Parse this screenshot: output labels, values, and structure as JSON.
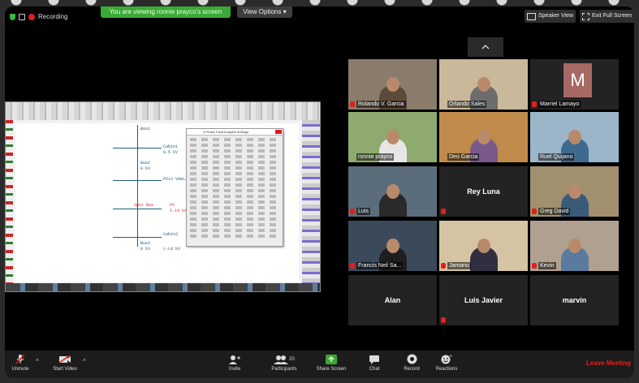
{
  "top_bar": {
    "recording_label": "Recording",
    "viewing_banner": "You are viewing ronnie prayco's screen",
    "view_options": "View Options ▾",
    "speaker_view": "Speaker View",
    "exit_full_screen": "Exit Full Screen"
  },
  "shared_screen": {
    "labels": {
      "bus1": "Bus1",
      "cabin1": "Cabin1",
      "cabin1_val": "0.5 kV",
      "bus2": "Bus2",
      "bus2_val": "0 kV",
      "cable": "PV13 VHeL/C3bSb",
      "spot_bus": "Spot Bus",
      "pv": "PV",
      "fault": "5.14 kA",
      "cabin2": "Cabin2",
      "bus3": "Bus3",
      "bus3_val": "0 kV",
      "load": "L-L0 kV"
    },
    "dialog_title": "3-Phase Fault Analysis Settings"
  },
  "participants": [
    {
      "name": "Rolando V. Garcia",
      "muted": true,
      "bg": "#8a7c6c",
      "shirt": "#5b4a3a"
    },
    {
      "name": "Orlando Sales",
      "muted": false,
      "bg": "#c9b99a",
      "shirt": "#6d6d6d"
    },
    {
      "name": "Marriel Lamayo",
      "muted": true,
      "avatar": "M"
    },
    {
      "name": "ronnie prayco",
      "muted": false,
      "active": true,
      "bg": "#8faa6f",
      "shirt": "#e6e6e6"
    },
    {
      "name": "Deo Garcia",
      "muted": false,
      "bg": "#c08a4a",
      "shirt": "#7a5a8a"
    },
    {
      "name": "Ruel Quijano",
      "muted": false,
      "bg": "#9bb5c9",
      "shirt": "#3e6a8f"
    },
    {
      "name": "Luis",
      "muted": true,
      "bg": "#5b6d7a",
      "shirt": "#2a2a2a"
    },
    {
      "name": "Rey Luna",
      "muted": true,
      "camera_off": true
    },
    {
      "name": "Greg David",
      "muted": true,
      "bg": "#a0906e",
      "shirt": "#3a5a7a"
    },
    {
      "name": "Francis Neil Sa...",
      "muted": true,
      "bg": "#3a4a5a",
      "shirt": "#1e1e1e"
    },
    {
      "name": "Jamano",
      "muted": true,
      "bg": "#d4c4a4",
      "shirt": "#2f2f3f"
    },
    {
      "name": "Kevin",
      "muted": true,
      "bg": "#b0a090",
      "shirt": "#5a7aa0"
    },
    {
      "name": "Alan",
      "muted": false,
      "camera_off": true
    },
    {
      "name": "Luis Javier",
      "muted": true,
      "camera_off": true
    },
    {
      "name": "marvin",
      "muted": false,
      "camera_off": true
    }
  ],
  "toolbar": {
    "unmute": "Unmute",
    "start_video": "Start Video",
    "invite": "Invite",
    "participants": "Participants",
    "participant_count": "20",
    "share_screen": "Share Screen",
    "chat": "Chat",
    "record": "Record",
    "reactions": "Reactions",
    "leave_meeting": "Leave Meeting"
  },
  "colors": {
    "recording": "#e0201c",
    "share_green": "#3aa935",
    "active_speaker": "#c7f041"
  }
}
